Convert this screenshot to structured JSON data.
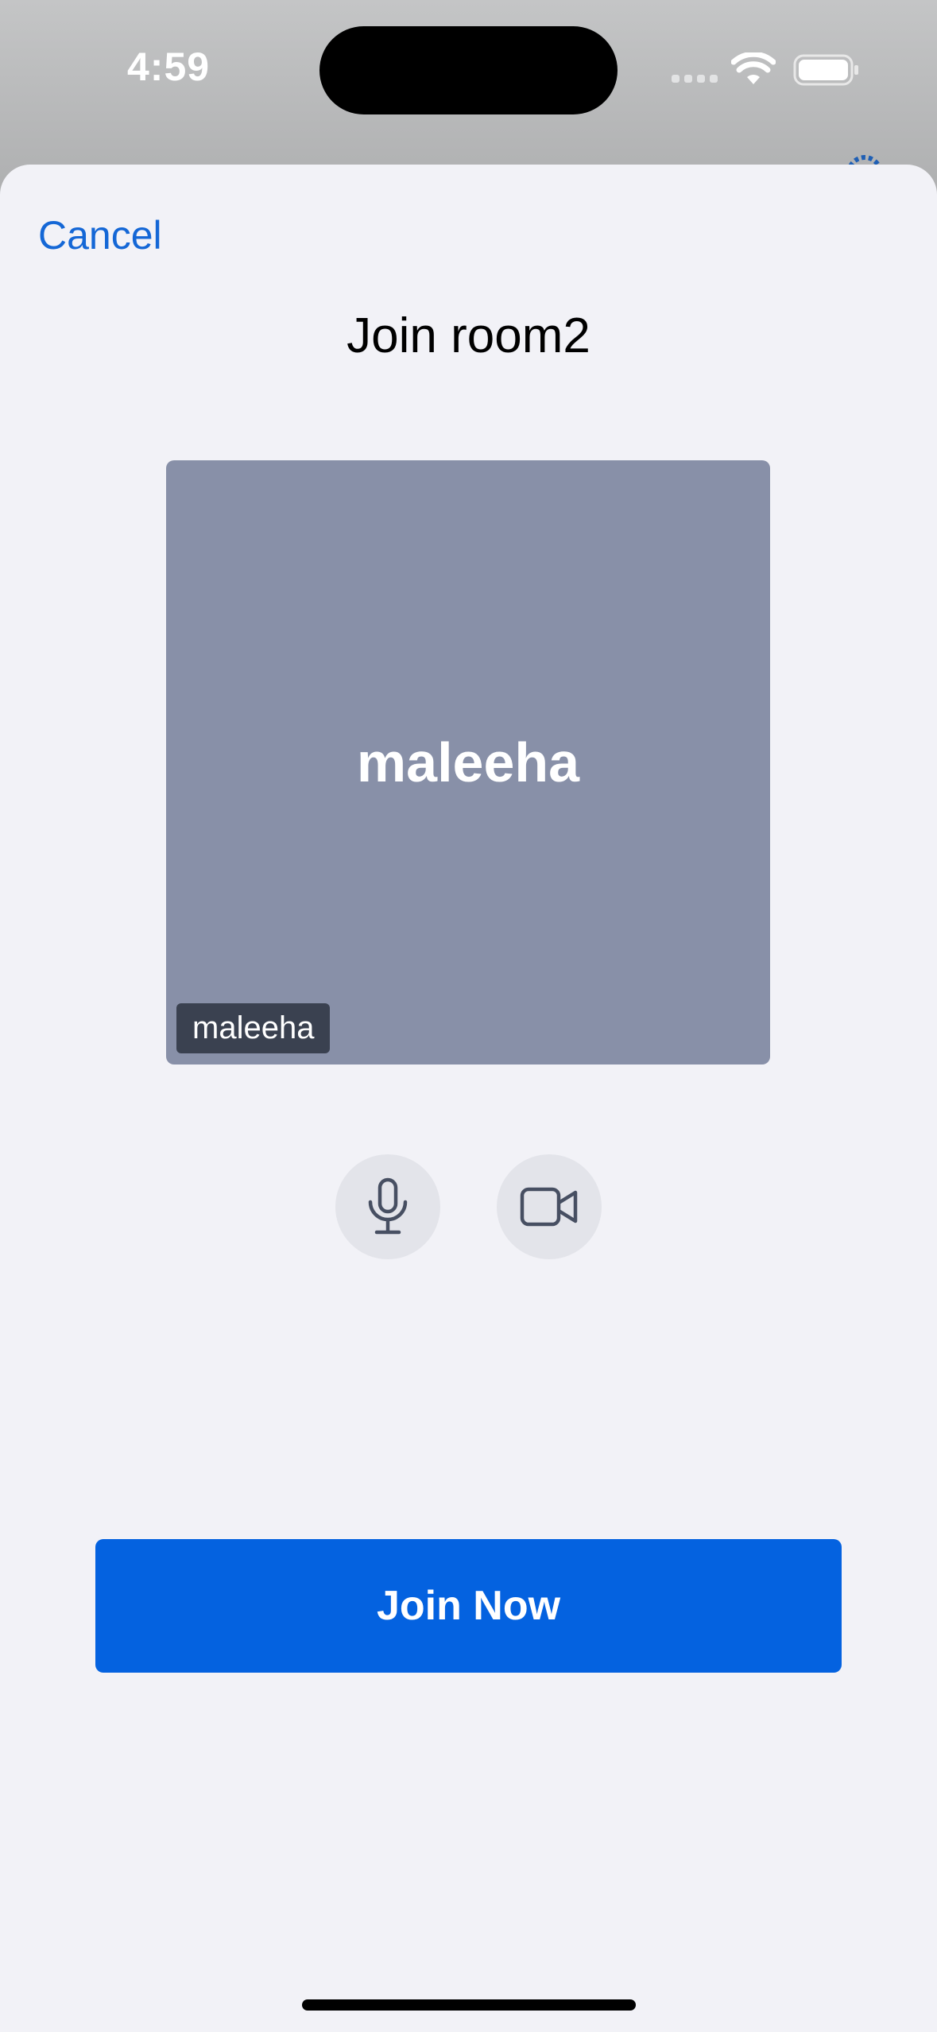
{
  "status_bar": {
    "time": "4:59",
    "icons": [
      "cellular-dots-icon",
      "wifi-icon",
      "battery-icon"
    ]
  },
  "background": {
    "icon": "gear-icon",
    "accent": "#1f5fb4"
  },
  "sheet": {
    "cancel_label": "Cancel",
    "title": "Join room2"
  },
  "preview": {
    "display_name": "maleeha",
    "name_badge": "maleeha",
    "tile_color": "#8890a8"
  },
  "controls": {
    "mic_icon": "microphone-icon",
    "camera_icon": "video-camera-icon"
  },
  "join_button": {
    "label": "Join Now",
    "color": "#0462e0"
  },
  "colors": {
    "accent": "#1467d6",
    "sheet_bg": "#f2f2f7",
    "control_bg": "#e3e4ea"
  }
}
